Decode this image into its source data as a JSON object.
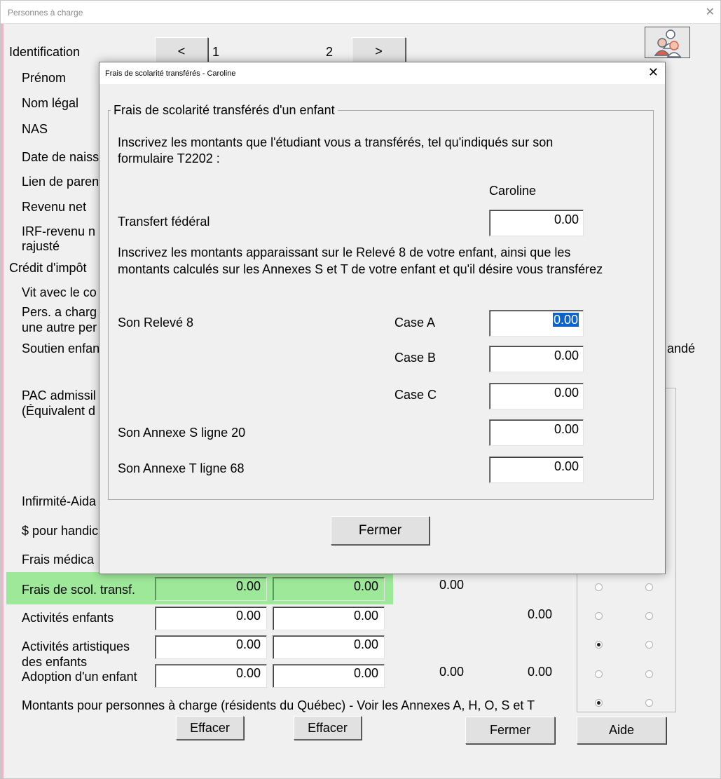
{
  "main_window": {
    "title": "Personnes à charge",
    "nav": {
      "prev": "<",
      "next": ">",
      "col1": "1",
      "col2": "2"
    },
    "labels": {
      "identification": "Identification",
      "prenom": "Prénom",
      "nom_legal": "Nom légal",
      "nas": "NAS",
      "date_naiss": "Date de naiss",
      "lien_parente": "Lien de paren",
      "revenu_net": "Revenu net",
      "irf_line1": "IRF-revenu n",
      "irf_line2": "rajusté",
      "credit_impot": "Crédit d'impôt",
      "vit_avec": "Vit avec le co",
      "pers_charge_1": "Pers. a charg",
      "pers_charge_2": "une autre per",
      "soutien": "Soutien enfan",
      "demande_fragment": "andé",
      "pac_1": "PAC admissil",
      "pac_2": "(Équivalent d",
      "infirmite": "Infirmité-Aida",
      "handicap": "$ pour handic",
      "frais_medicaux": "Frais médica",
      "frais_scol": "Frais de scol. transf.",
      "activites_enfants": "Activités enfants",
      "activites_artistiques_1": "Activités artistiques",
      "activites_artistiques_2": "des enfants",
      "adoption": "Adoption d'un enfant",
      "footer_note": "Montants pour personnes à charge (résidents du Québec) - Voir les Annexes A, H, O, S et T"
    },
    "rows": {
      "frais_scol": {
        "col1": "0.00",
        "col2": "0.00",
        "extra1": "0.00"
      },
      "activites_enfants": {
        "col1": "0.00",
        "col2": "0.00",
        "extra2": "0.00"
      },
      "activites_artistiques": {
        "col1": "0.00",
        "col2": "0.00"
      },
      "adoption": {
        "col1": "0.00",
        "col2": "0.00",
        "extra1": "0.00",
        "extra2": "0.00"
      }
    },
    "buttons": {
      "effacer1": "Effacer",
      "effacer2": "Effacer",
      "fermer": "Fermer",
      "aide": "Aide"
    }
  },
  "dialog": {
    "title": "Frais de scolarité transférés - Caroline",
    "close_glyph": "✕",
    "group_title": "Frais de scolarité transférés d'un enfant",
    "instruction1_line1": "Inscrivez les montants que l'étudiant vous a transférés, tel qu'indiqués sur son",
    "instruction1_line2": "formulaire T2202 :",
    "column_header": "Caroline",
    "transfert_federal_label": "Transfert fédéral",
    "transfert_federal_value": "0.00",
    "instruction2_line1": "Inscrivez les montants apparaissant sur le Relevé 8 de votre enfant, ainsi que les",
    "instruction2_line2": "montants calculés sur les Annexes S et T de votre enfant et qu'il désire vous transférez",
    "releve8_label": "Son Relevé 8",
    "case_a_label": "Case A",
    "case_a_value": "0.00",
    "case_b_label": "Case B",
    "case_b_value": "0.00",
    "case_c_label": "Case C",
    "case_c_value": "0.00",
    "annexe_s_label": "Son Annexe S ligne 20",
    "annexe_s_value": "0.00",
    "annexe_t_label": "Son Annexe T ligne 68",
    "annexe_t_value": "0.00",
    "fermer_button": "Fermer"
  },
  "colors": {
    "highlight_green": "#9ee89a",
    "selection_blue": "#0a64d0",
    "pink_strip": "#e8b7c8"
  },
  "icons": {
    "avatar": "dependents-people-icon",
    "close": "close-icon"
  }
}
